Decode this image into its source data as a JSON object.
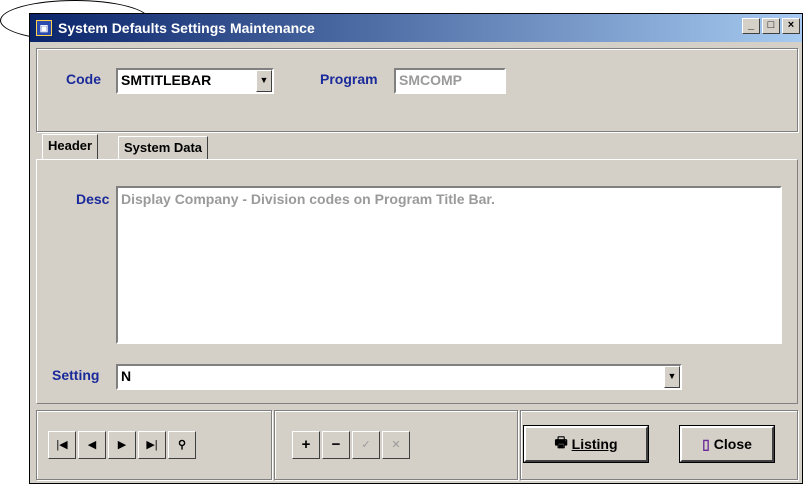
{
  "window": {
    "title": "System Defaults Settings Maintenance",
    "icon_name": "app-icon"
  },
  "titlebar_buttons": {
    "minimize": "_",
    "maximize": "□",
    "close": "×"
  },
  "code": {
    "label": "Code",
    "value": "SMTITLEBAR"
  },
  "program": {
    "label": "Program",
    "value": "SMCOMP"
  },
  "tabs": [
    {
      "label": "Header"
    },
    {
      "label": "System Data"
    }
  ],
  "desc": {
    "label": "Desc",
    "value": "Display Company - Division codes on Program Title Bar."
  },
  "setting": {
    "label": "Setting",
    "value": "N"
  },
  "nav": {
    "first": "|◀",
    "prev": "◀",
    "next": "▶",
    "last": "▶|",
    "find": "👁"
  },
  "edit": {
    "add": "+",
    "remove": "−",
    "accept": "✓",
    "cancel": "✕"
  },
  "buttons": {
    "listing": "Listing",
    "close": "Close"
  },
  "colors": {
    "label_color": "#1a2a9a",
    "title_gradient_start": "#0a246a"
  }
}
